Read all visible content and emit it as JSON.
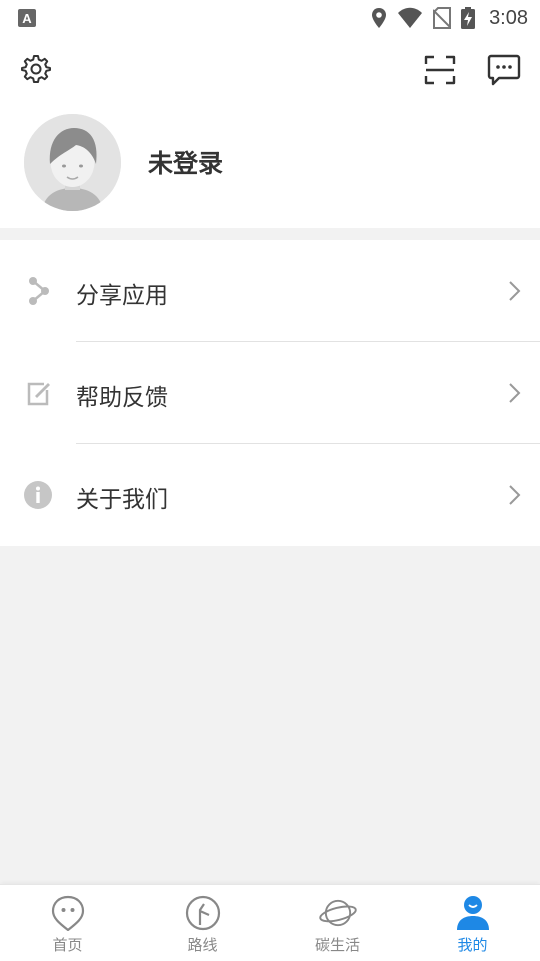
{
  "status_bar": {
    "time": "3:08",
    "left_icon": "text-a-icon",
    "icons": [
      "location-icon",
      "wifi-icon",
      "no-sim-icon",
      "battery-charging-icon"
    ]
  },
  "header": {
    "settings_icon": "gear-icon",
    "scan_icon": "scan-icon",
    "message_icon": "message-icon",
    "username": "未登录"
  },
  "menu": {
    "items": [
      {
        "label": "分享应用",
        "icon": "share-icon"
      },
      {
        "label": "帮助反馈",
        "icon": "edit-icon"
      },
      {
        "label": "关于我们",
        "icon": "info-icon"
      }
    ]
  },
  "tabbar": {
    "tabs": [
      {
        "label": "首页",
        "icon": "home-face-icon",
        "active": false
      },
      {
        "label": "路线",
        "icon": "route-icon",
        "active": false
      },
      {
        "label": "碳生活",
        "icon": "planet-icon",
        "active": false
      },
      {
        "label": "我的",
        "icon": "user-icon",
        "active": true
      }
    ]
  },
  "colors": {
    "accent": "#1e88e5",
    "background": "#f2f2f2",
    "text": "#333333",
    "muted": "#888888"
  }
}
